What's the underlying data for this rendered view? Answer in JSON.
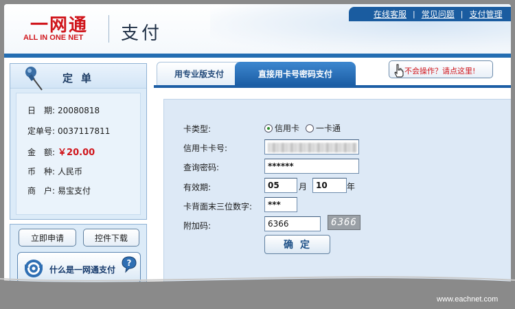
{
  "logo": {
    "cn": "一网通",
    "en": "ALL IN ONE NET"
  },
  "header": {
    "title": "支付"
  },
  "top_links": [
    "在线客服",
    "常见问题",
    "支付管理"
  ],
  "order": {
    "title": "定单",
    "rows": [
      {
        "label": "日　期:",
        "value": "20080818"
      },
      {
        "label": "定单号:",
        "value": "0037117811"
      },
      {
        "label": "金　额:",
        "value": "￥20.00"
      },
      {
        "label": "币　种:",
        "value": "人民币"
      },
      {
        "label": "商　户:",
        "value": "易宝支付"
      }
    ]
  },
  "side": {
    "apply_label": "立即申请",
    "download_label": "控件下载",
    "whatis_label": "什么是一网通支付"
  },
  "help": {
    "label": "不会操作？请点这里!"
  },
  "tabs": {
    "pro": "用专业版支付",
    "direct": "直接用卡号密码支付"
  },
  "form": {
    "card_type_label": "卡类型:",
    "card_type_options": [
      "信用卡",
      "一卡通"
    ],
    "card_type_selected": "信用卡",
    "card_no_label": "信用卡卡号:",
    "query_pwd_label": "查询密码:",
    "query_pwd_value": "******",
    "expiry_label": "有效期:",
    "expiry_month": "05",
    "month_unit": "月",
    "expiry_year": "10",
    "year_unit": "年",
    "cvv_label": "卡背面末三位数字:",
    "cvv_value": "***",
    "extra_code_label": "附加码:",
    "extra_code_value": "6366",
    "captcha_text": "6366",
    "confirm_label": "确定"
  },
  "footer": {
    "site": "www.eachnet.com"
  },
  "colors": {
    "brand_red": "#d0151b",
    "nav_blue": "#1a5ca0",
    "panel_blue": "#dde9f6"
  }
}
